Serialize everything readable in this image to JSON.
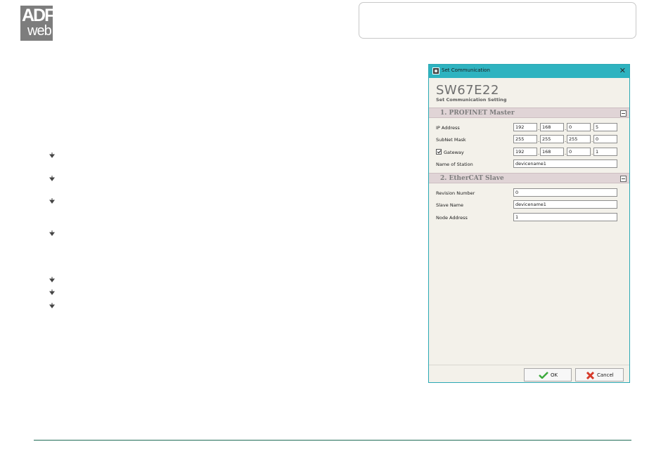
{
  "logo": {
    "line1": "ADF",
    "line2": "web"
  },
  "dialog": {
    "window_title": "Set Communication",
    "close_glyph": "✕",
    "product": "SW67E22",
    "subtitle": "Set Communication Setting",
    "section1": {
      "title": "1. PROFINET Master",
      "ip_label": "IP Address",
      "ip": [
        "192",
        "168",
        "0",
        "5"
      ],
      "subnet_label": "SubNet Mask",
      "subnet": [
        "255",
        "255",
        "255",
        "0"
      ],
      "gateway_label": "Gateway",
      "gateway_checked": true,
      "gateway": [
        "192",
        "168",
        "0",
        "1"
      ],
      "station_label": "Name of Station",
      "station": "devicename1"
    },
    "section2": {
      "title": "2. EtherCAT Slave",
      "revision_label": "Revision Number",
      "revision": "0",
      "slave_name_label": "Slave Name",
      "slave_name": "devicename1",
      "node_label": "Node Address",
      "node": "1"
    },
    "ok_label": "OK",
    "cancel_label": "Cancel"
  },
  "colors": {
    "titlebar": "#2eb3c0",
    "section_header": "#e0d4d6",
    "footer_line": "#1f6b56",
    "logo_bg": "#7d7d7d"
  }
}
